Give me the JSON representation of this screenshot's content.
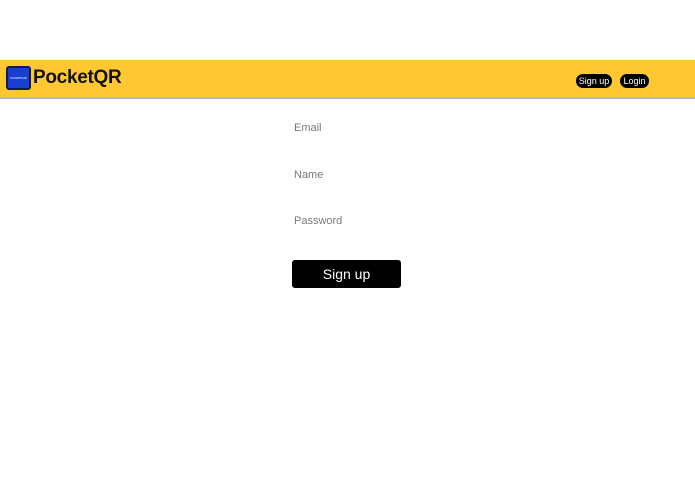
{
  "navbar": {
    "brand": "PocketQR",
    "logo_text": "POCKETQR",
    "signup_label": "Sign up",
    "login_label": "Login",
    "background_color": "#ffc832"
  },
  "form": {
    "email_placeholder": "Email",
    "name_placeholder": "Name",
    "password_placeholder": "Password",
    "submit_label": "Sign up"
  }
}
